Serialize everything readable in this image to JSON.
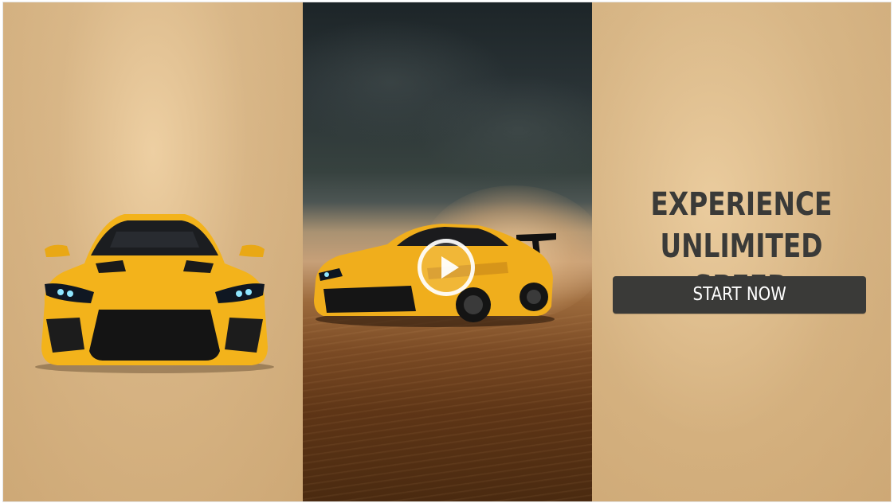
{
  "hero": {
    "headline_line1": "EXPERIENCE",
    "headline_line2": "UNLIMITED SPEED",
    "cta_label": "START NOW"
  },
  "media": {
    "left_image": "yellow-sports-car-front",
    "video_thumbnail": "yellow-sports-car-drifting-desert",
    "play_icon": "play-icon"
  },
  "colors": {
    "sand": "#d7b688",
    "car_yellow": "#f2b21c",
    "text_dark": "#3a3a38",
    "button_bg": "#3a3a38",
    "button_text": "#ffffff"
  }
}
